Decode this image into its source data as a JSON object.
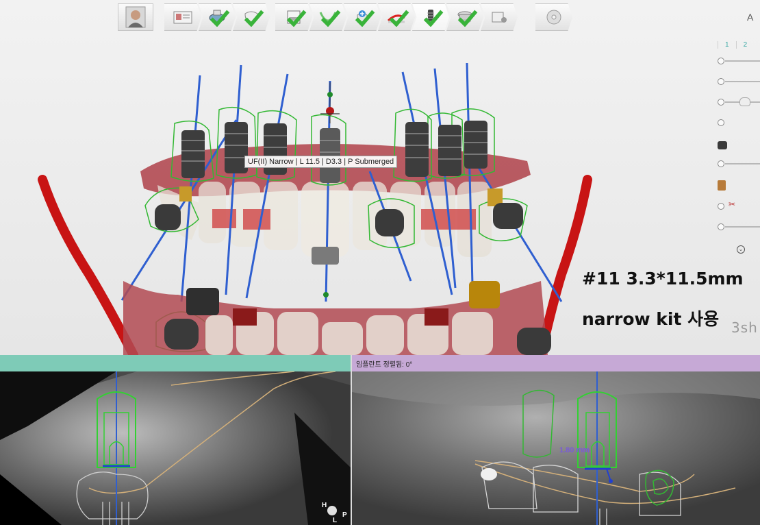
{
  "toolbar": {
    "patient_icon": "patient-photo-icon",
    "steps": [
      {
        "icon": "patient-card-icon",
        "done": false
      },
      {
        "icon": "scan-import-icon",
        "done": true
      },
      {
        "icon": "tooth-icon",
        "done": true
      },
      {
        "icon": "window-icon",
        "done": true
      },
      {
        "icon": "arch-curve-icon",
        "done": true
      },
      {
        "icon": "tooth-add-icon",
        "done": true
      },
      {
        "icon": "nerve-icon",
        "done": true
      },
      {
        "icon": "implant-icon",
        "done": true,
        "active": true
      },
      {
        "icon": "sleeve-icon",
        "done": true
      },
      {
        "icon": "guide-settings-icon",
        "done": false
      },
      {
        "icon": "disc-icon",
        "done": false
      }
    ]
  },
  "side_panel": {
    "tab_numbers": [
      "1",
      "2"
    ]
  },
  "viewport": {
    "tooltip": "UF(II) Narrow | L 11.5 | D3.3 | P Submerged",
    "caption_line1": "#11 3.3*11.5mm",
    "caption_line2": "narrow kit 사용",
    "watermark": "3sh"
  },
  "ct_left": {
    "title": "",
    "orientation": [
      "H",
      "L",
      "P"
    ]
  },
  "ct_right": {
    "title": "임플란트 정렬됨: 0°",
    "measurement": "1.80 mm"
  },
  "colors": {
    "implant_axis": "#2f5fd0",
    "guide_outline": "#33b833",
    "nerve": "#d01010",
    "gingiva": "#b24a52",
    "left_header": "#7ecbb7",
    "right_header": "#c6a9d6"
  }
}
